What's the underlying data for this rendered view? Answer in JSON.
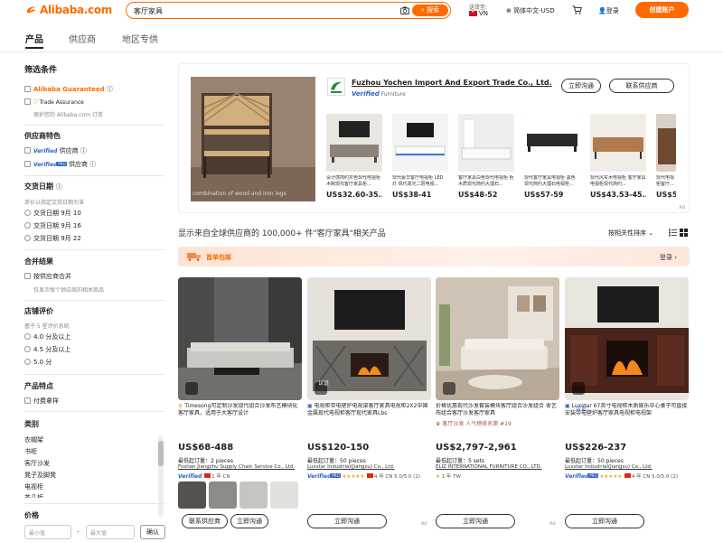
{
  "header": {
    "logo": "Alibaba.com",
    "search_value": "客厅家具",
    "search_button": "搜索",
    "deliver_to": "送货至:",
    "country": "VN",
    "language": "简体中文-USD",
    "login": "登录",
    "create_account": "创建账户"
  },
  "tabs": [
    {
      "label": "产品",
      "active": true
    },
    {
      "label": "供应商",
      "active": false
    },
    {
      "label": "地区专供",
      "active": false
    }
  ],
  "sidebar": {
    "filters_title": "筛选条件",
    "guaranteed": "Alibaba Guaranteed",
    "trade_assurance": "Trade Assurance",
    "trade_note": "保护您的 Alibaba.com 订单",
    "supplier_title": "供应商特色",
    "verified_label": "Verified",
    "supplier_verified": "供应商",
    "pro_label": "PRO",
    "supplier_pro": "供应商",
    "delivery_title": "交货日期",
    "delivery_note": "单价以指定交货日期为准",
    "delivery_options": [
      "交货日期 9月 10",
      "交货日期 9月 16",
      "交货日期 9月 22"
    ],
    "merge_title": "合并结果",
    "merge_option": "按供应商合并",
    "merge_note": "仅显示每个供应商的相关商品",
    "rating_title": "店铺评价",
    "rating_note": "基于 5 星评价系统",
    "rating_options": [
      "4.0 分及以上",
      "4.5 分及以上",
      "5.0 分"
    ],
    "features_title": "产品特点",
    "features_option": "付费拿样",
    "category_title": "类别",
    "categories": [
      "衣帽架",
      "书柜",
      "客厅沙发",
      "凳子及脚凳",
      "电视柜",
      "茶几柜"
    ],
    "price_title": "价格",
    "price_min": "最小值",
    "price_max": "最大值",
    "price_dash": "-",
    "confirm": "确认"
  },
  "banner": {
    "image_caption": "combination of wood and iron legs",
    "supplier_name": "Fuzhou Yochen Import And Export Trade Co., Ltd.",
    "verified": "Verified",
    "category": "Furniture",
    "chat_button": "立即沟通",
    "contact_button": "联系供应商",
    "ad": "Ad",
    "products": [
      {
        "title": "设计感简约灰色现代电视柜 木制现代客厅家具柜...",
        "price": "US$32.60-35..."
      },
      {
        "title": "现代豪华客厅电视柜 LED 灯 现代高光二层电视...",
        "price": "US$38-41"
      },
      {
        "title": "客厅家具白色现代电视柜 柜木质现代简约大理石...",
        "price": "US$48-52"
      },
      {
        "title": "现代客厅家具电视柜 黑色 现代简约大理石电视柜...",
        "price": "US$57-59"
      },
      {
        "title": "现代风实木电视柜 客厅家具 电视柜现代简约...",
        "price": "US$43.53-45..."
      },
      {
        "title": "现代电视柜客厅...",
        "price": "US$5..."
      }
    ]
  },
  "results": {
    "title": "显示来自全球供应商的 100,000+ 件\"客厅家具\"相关产品",
    "sort": "按相关性排序",
    "promo_label": "首单包邮",
    "promo_more": "登录"
  },
  "products": [
    {
      "title": "Timesong可定制沙发现代组合沙发布艺模块化客厅家具，适用于大客厅设计",
      "price": "US$68-488",
      "moq": "最低起订量：2 pieces",
      "company": "Foshan Jiangzhu Supply Chain Service Co., Ltd.",
      "meta": "1 年  CN",
      "buttons": [
        "联系供应商",
        "立即沟通"
      ]
    },
    {
      "title": "电视柜带电壁炉电视架客厅家具电视柜2X2中国金属现代电视柜客厅现代家具Lbs",
      "cert": "认证",
      "price": "US$120-150",
      "moq": "最低起订量：50 pieces",
      "company": "Luxstar Industrial(Jiangsu) Co., Ltd.",
      "meta": "4 年  CN  5.0/5.0 (2)",
      "buttons": [
        "立即沟通"
      ]
    },
    {
      "title": "价格优惠现代沙发套装模块客厅组合沙发组合 舍艺布组合客厅沙发客厅家具",
      "subnote": "客厅沙发 人气榜排名第 #19",
      "price": "US$2,797-2,961",
      "moq": "最低起订量：5 sets",
      "company": "ELIZ INTERNATIONAL FURNITURE CO., LTD.",
      "meta": "1 年  TW",
      "buttons": [
        "立即沟通"
      ]
    },
    {
      "title": "Luxstar 67英寸电视柜木质娱乐中心桌子可直接安装带电壁炉客厅家具电视柜电视架",
      "cert": "认证",
      "price": "US$226-237",
      "moq": "最低起订量：50 pieces",
      "company": "Luxstar Industrial(Jiangsu) Co., Ltd.",
      "meta": "4 年  CN  5.0/5.0 (2)",
      "buttons": [
        "立即沟通"
      ]
    }
  ],
  "ad": "Ad"
}
